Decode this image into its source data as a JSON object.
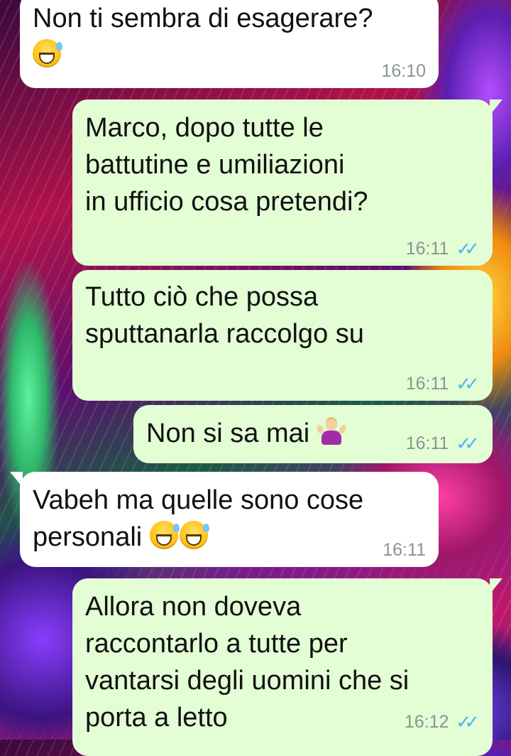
{
  "messages": [
    {
      "direction": "incoming",
      "text": "Non ti sembra di esagerare?",
      "emojis": [
        "grinning-face-with-sweat"
      ],
      "time": "16:10"
    },
    {
      "direction": "outgoing",
      "text": "Marco, dopo tutte le\nbattutine e umiliazioni\nin ufficio cosa pretendi?",
      "time": "16:11",
      "status": "read"
    },
    {
      "direction": "outgoing",
      "text": "Tutto ciò che possa\nsputtanarla raccolgo su",
      "time": "16:11",
      "status": "read"
    },
    {
      "direction": "outgoing",
      "text": "Non si sa mai",
      "emojis": [
        "person-shrugging"
      ],
      "time": "16:11",
      "status": "read"
    },
    {
      "direction": "incoming",
      "text": "Vabeh ma quelle sono cose\npersonali",
      "emojis": [
        "grinning-face-with-sweat",
        "grinning-face-with-sweat"
      ],
      "time": "16:11"
    },
    {
      "direction": "outgoing",
      "text": "Allora non doveva\nraccontarlo a tutte per\nvantarsi degli uomini che si\nporta a letto",
      "time": "16:12",
      "status": "read"
    }
  ],
  "colors": {
    "incoming_bubble": "#ffffff",
    "outgoing_bubble": "#e3fdd5",
    "read_ticks": "#4fb6ec",
    "timestamp": "#8a9590"
  }
}
